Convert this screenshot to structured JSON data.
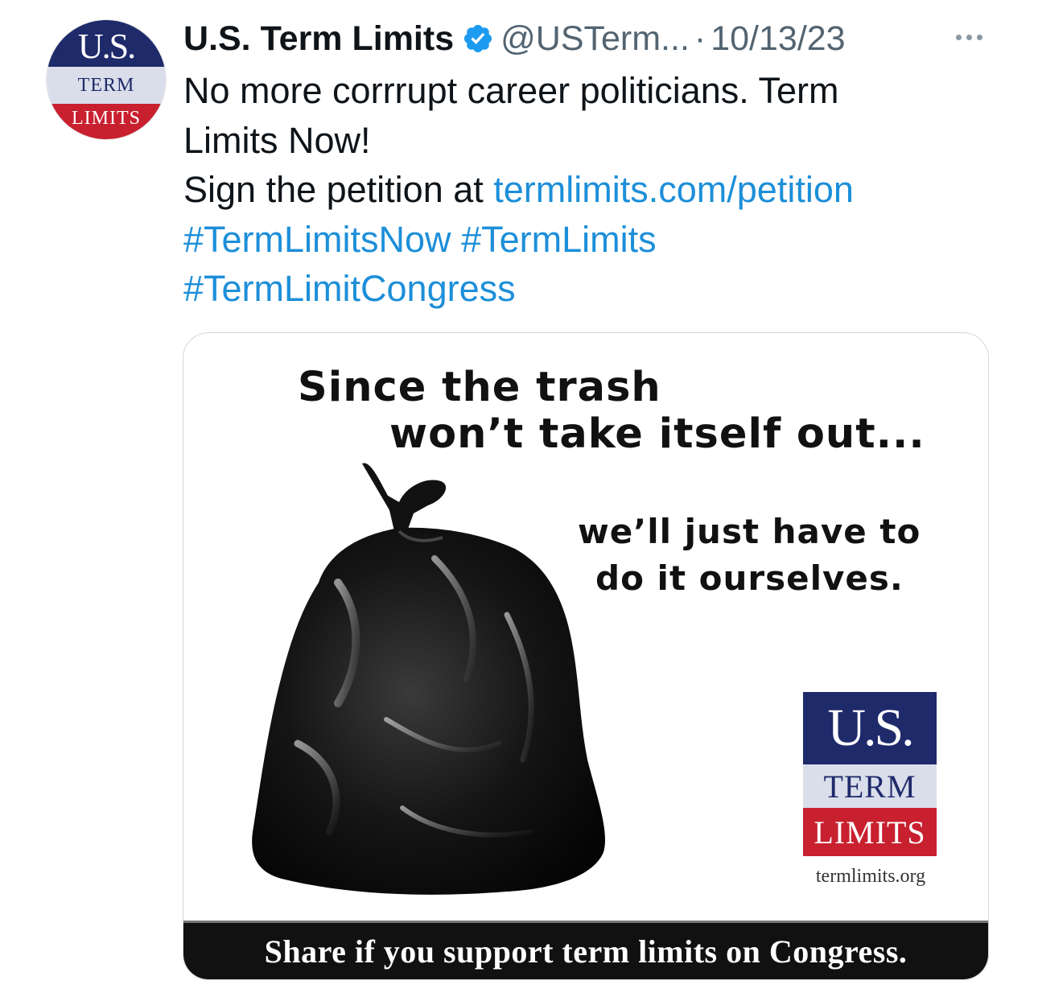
{
  "tweet": {
    "author_name": "U.S. Term Limits",
    "handle": "@USTerm...",
    "separator": "·",
    "date": "10/13/23",
    "avatar": {
      "line1": "U.S.",
      "line2": "TERM",
      "line3": "LIMITS"
    },
    "text_line1": "No more corrrupt career politicians. Term",
    "text_line2": "Limits Now!",
    "text_line3_prefix": "Sign the petition at ",
    "link": "termlimits.com/petition",
    "hashtag1": "#TermLimitsNow",
    "hashtag2": "#TermLimits",
    "hashtag3": "#TermLimitCongress"
  },
  "media": {
    "headline1": "Since the trash",
    "headline2": "won’t take itself out...",
    "sub1": "we’ll just have to",
    "sub2": "do it ourselves.",
    "logo": {
      "line1": "U.S.",
      "line2": "TERM",
      "line3": "LIMITS",
      "url": "termlimits.org"
    },
    "footer": "Share if you support term limits on Congress."
  },
  "icons": {
    "verified": "verified-badge-icon",
    "more": "more-options-icon",
    "bag": "trash-bag-image"
  },
  "colors": {
    "link": "#1d8fd9",
    "brand_blue": "#1f2a6b",
    "brand_red": "#c8202f",
    "verified": "#1d9bf0"
  }
}
